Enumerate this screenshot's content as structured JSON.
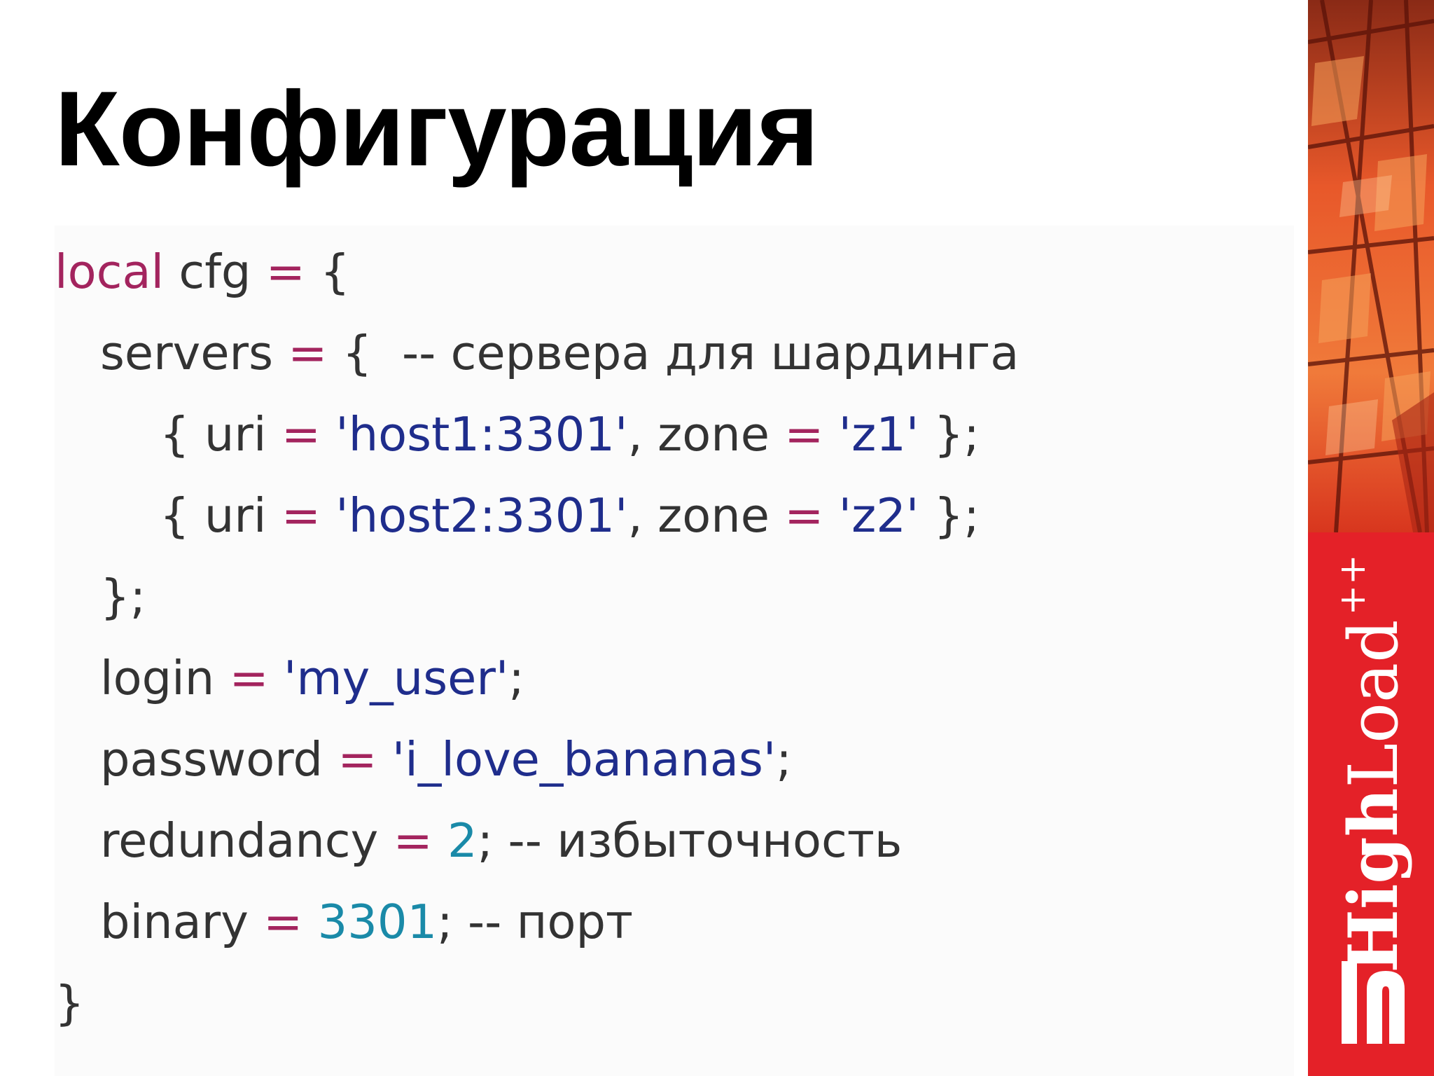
{
  "title": "Конфигурация",
  "code": {
    "line1": {
      "kw": "local",
      "name": " cfg ",
      "op": "=",
      "rest": " {"
    },
    "line2": {
      "name": "servers ",
      "op": "=",
      "rest": " {  -- сервера для шардинга"
    },
    "line3": {
      "open": "{ uri ",
      "op1": "=",
      "str1": " 'host1:3301'",
      "mid": ", zone ",
      "op2": "=",
      "str2": " 'z1'",
      "close": " };"
    },
    "line4": {
      "open": "{ uri ",
      "op1": "=",
      "str1": " 'host2:3301'",
      "mid": ", zone ",
      "op2": "=",
      "str2": " 'z2'",
      "close": " };"
    },
    "line5": {
      "text": "};"
    },
    "line6": {
      "name": "login ",
      "op": "=",
      "str": " 'my_user'",
      "rest": ";"
    },
    "line7": {
      "name": "password ",
      "op": "=",
      "str": " 'i_love_bananas'",
      "rest": ";"
    },
    "line8": {
      "name": "redundancy ",
      "op": "=",
      "num": " 2",
      "rest": "; -- избыточность"
    },
    "line9": {
      "name": "binary ",
      "op": "=",
      "num": " 3301",
      "rest": "; -- порт"
    },
    "line10": {
      "text": "}"
    }
  },
  "logo": {
    "high": "High",
    "load": "Load",
    "plus": "++"
  },
  "colors": {
    "keyword": "#a3245e",
    "string": "#1f2d8c",
    "number": "#1a8aa8",
    "text": "#333333",
    "brand_red": "#e42128"
  }
}
